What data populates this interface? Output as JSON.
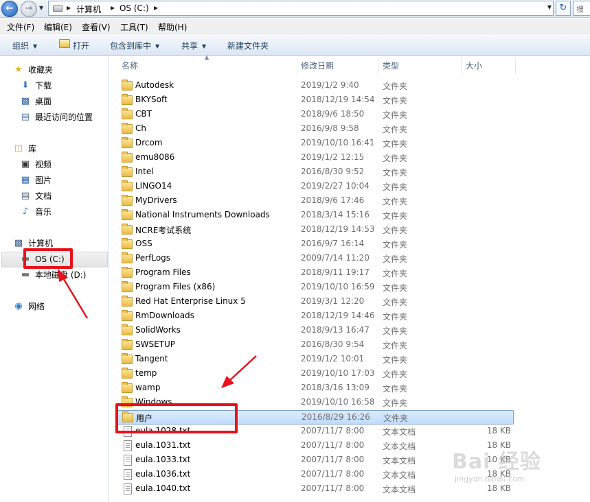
{
  "address": {
    "crumbs": [
      "计算机",
      "OS (C:)"
    ],
    "search_placeholder": "搜"
  },
  "menu": [
    "文件(F)",
    "编辑(E)",
    "查看(V)",
    "工具(T)",
    "帮助(H)"
  ],
  "toolbar": {
    "organize": "组织",
    "open": "打开",
    "include": "包含到库中",
    "share": "共享",
    "new_folder": "新建文件夹"
  },
  "nav": {
    "favorites": "收藏夹",
    "downloads": "下载",
    "desktop": "桌面",
    "recent": "最近访问的位置",
    "libraries": "库",
    "videos": "视频",
    "pictures": "图片",
    "documents": "文档",
    "music": "音乐",
    "computer": "计算机",
    "drive_c": "OS (C:)",
    "drive_d": "本地磁盘 (D:)",
    "network": "网络"
  },
  "columns": {
    "name": "名称",
    "date": "修改日期",
    "type": "类型",
    "size": "大小"
  },
  "files": [
    {
      "name": "Autodesk",
      "date": "2019/1/2 9:40",
      "type": "文件夹",
      "size": "",
      "kind": "folder"
    },
    {
      "name": "BKYSoft",
      "date": "2018/12/19 14:54",
      "type": "文件夹",
      "size": "",
      "kind": "folder"
    },
    {
      "name": "CBT",
      "date": "2018/9/6 18:50",
      "type": "文件夹",
      "size": "",
      "kind": "folder"
    },
    {
      "name": "Ch",
      "date": "2016/9/8 9:58",
      "type": "文件夹",
      "size": "",
      "kind": "folder"
    },
    {
      "name": "Drcom",
      "date": "2019/10/10 16:41",
      "type": "文件夹",
      "size": "",
      "kind": "folder"
    },
    {
      "name": "emu8086",
      "date": "2019/1/2 12:15",
      "type": "文件夹",
      "size": "",
      "kind": "folder"
    },
    {
      "name": "Intel",
      "date": "2016/8/30 9:52",
      "type": "文件夹",
      "size": "",
      "kind": "folder"
    },
    {
      "name": "LINGO14",
      "date": "2019/2/27 10:04",
      "type": "文件夹",
      "size": "",
      "kind": "folder"
    },
    {
      "name": "MyDrivers",
      "date": "2018/9/6 17:46",
      "type": "文件夹",
      "size": "",
      "kind": "folder"
    },
    {
      "name": "National Instruments Downloads",
      "date": "2018/3/14 15:16",
      "type": "文件夹",
      "size": "",
      "kind": "folder"
    },
    {
      "name": "NCRE考试系统",
      "date": "2018/12/19 14:53",
      "type": "文件夹",
      "size": "",
      "kind": "folder"
    },
    {
      "name": "OSS",
      "date": "2016/9/7 16:14",
      "type": "文件夹",
      "size": "",
      "kind": "folder"
    },
    {
      "name": "PerfLogs",
      "date": "2009/7/14 11:20",
      "type": "文件夹",
      "size": "",
      "kind": "folder"
    },
    {
      "name": "Program Files",
      "date": "2018/9/11 19:17",
      "type": "文件夹",
      "size": "",
      "kind": "folder"
    },
    {
      "name": "Program Files (x86)",
      "date": "2019/10/10 16:59",
      "type": "文件夹",
      "size": "",
      "kind": "folder"
    },
    {
      "name": "Red Hat Enterprise Linux 5",
      "date": "2019/3/1 12:20",
      "type": "文件夹",
      "size": "",
      "kind": "folder"
    },
    {
      "name": "RmDownloads",
      "date": "2018/12/19 14:46",
      "type": "文件夹",
      "size": "",
      "kind": "folder"
    },
    {
      "name": "SolidWorks",
      "date": "2018/9/13 16:47",
      "type": "文件夹",
      "size": "",
      "kind": "folder"
    },
    {
      "name": "SWSETUP",
      "date": "2016/8/30 9:54",
      "type": "文件夹",
      "size": "",
      "kind": "folder"
    },
    {
      "name": "Tangent",
      "date": "2019/1/2 10:01",
      "type": "文件夹",
      "size": "",
      "kind": "folder"
    },
    {
      "name": "temp",
      "date": "2019/10/10 17:03",
      "type": "文件夹",
      "size": "",
      "kind": "folder"
    },
    {
      "name": "wamp",
      "date": "2018/3/16 13:09",
      "type": "文件夹",
      "size": "",
      "kind": "folder"
    },
    {
      "name": "Windows",
      "date": "2019/10/10 16:58",
      "type": "文件夹",
      "size": "",
      "kind": "folder"
    },
    {
      "name": "用户",
      "date": "2016/8/29 16:26",
      "type": "文件夹",
      "size": "",
      "kind": "folder",
      "selected": true
    },
    {
      "name": "eula.1028.txt",
      "date": "2007/11/7 8:00",
      "type": "文本文档",
      "size": "18 KB",
      "kind": "txt"
    },
    {
      "name": "eula.1031.txt",
      "date": "2007/11/7 8:00",
      "type": "文本文档",
      "size": "18 KB",
      "kind": "txt"
    },
    {
      "name": "eula.1033.txt",
      "date": "2007/11/7 8:00",
      "type": "文本文档",
      "size": "10 KB",
      "kind": "txt"
    },
    {
      "name": "eula.1036.txt",
      "date": "2007/11/7 8:00",
      "type": "文本文档",
      "size": "18 KB",
      "kind": "txt"
    },
    {
      "name": "eula.1040.txt",
      "date": "2007/11/7 8:00",
      "type": "文本文档",
      "size": "18 KB",
      "kind": "txt"
    }
  ],
  "annotation_color": "#e8111b",
  "watermark": {
    "brand": "Bai 经验",
    "url": "jingyan.baidu.com"
  }
}
